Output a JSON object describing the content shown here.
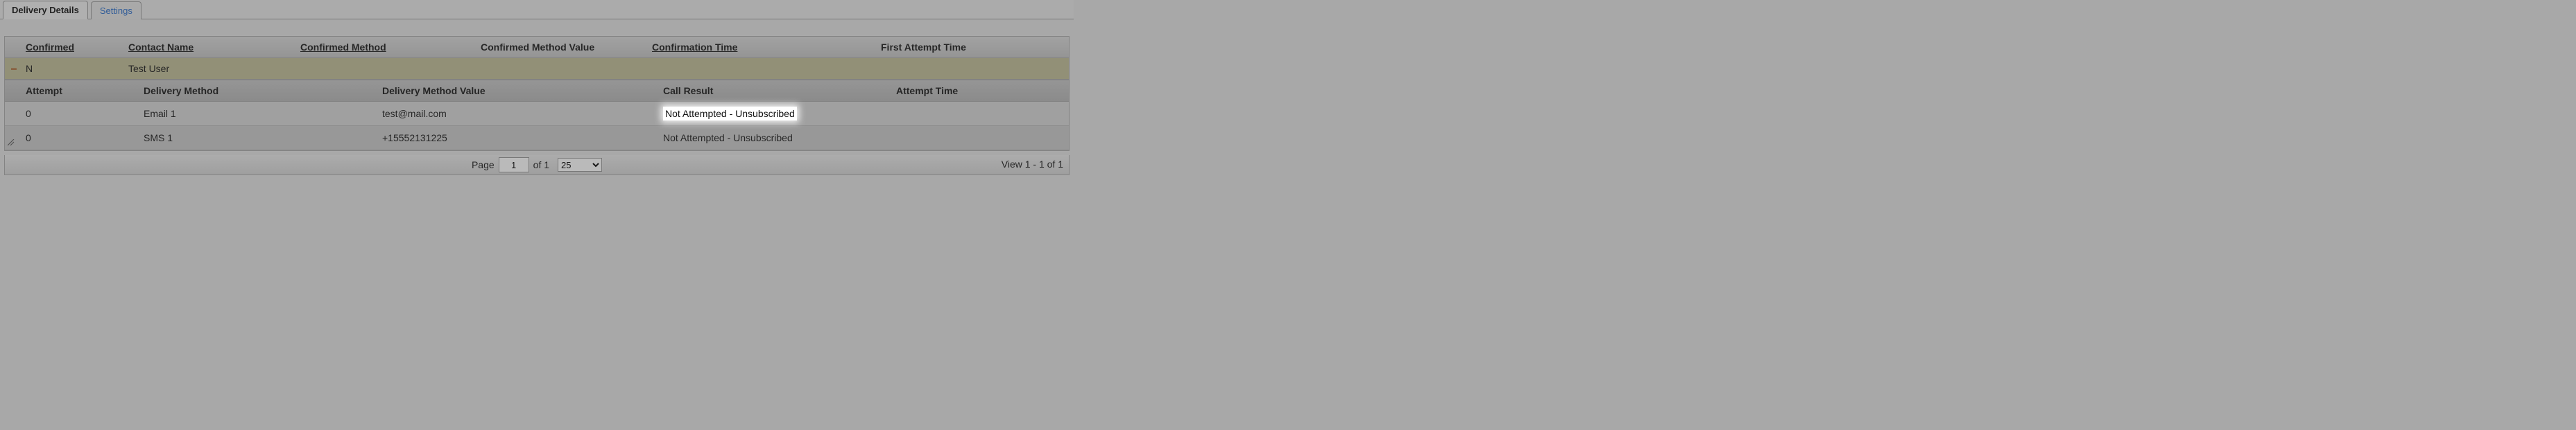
{
  "tabs": {
    "delivery_details": "Delivery Details",
    "settings": "Settings"
  },
  "outer_headers": {
    "confirmed": "Confirmed",
    "contact_name": "Contact Name",
    "confirmed_method": "Confirmed Method",
    "confirmed_method_value": "Confirmed Method Value",
    "confirmation_time": "Confirmation Time",
    "first_attempt_time": "First Attempt Time"
  },
  "outer_rows": [
    {
      "expander": "–",
      "confirmed": "N",
      "contact_name": "Test User",
      "confirmed_method": "",
      "confirmed_method_value": "",
      "confirmation_time": "",
      "first_attempt_time": ""
    }
  ],
  "inner_headers": {
    "attempt": "Attempt",
    "delivery_method": "Delivery Method",
    "delivery_method_value": "Delivery Method Value",
    "call_result": "Call Result",
    "attempt_time": "Attempt Time"
  },
  "inner_rows": [
    {
      "attempt": "0",
      "delivery_method": "Email 1",
      "delivery_method_value": "test@mail.com",
      "call_result": "Not Attempted - Unsubscribed",
      "attempt_time": "",
      "highlight": true
    },
    {
      "attempt": "0",
      "delivery_method": "SMS 1",
      "delivery_method_value": "+15552131225",
      "call_result": "Not Attempted - Unsubscribed",
      "attempt_time": "",
      "highlight": false
    }
  ],
  "pager": {
    "page_label": "Page",
    "page_value": "1",
    "of_label": "of 1",
    "page_size": "25",
    "view_label": "View 1 - 1 of 1"
  }
}
